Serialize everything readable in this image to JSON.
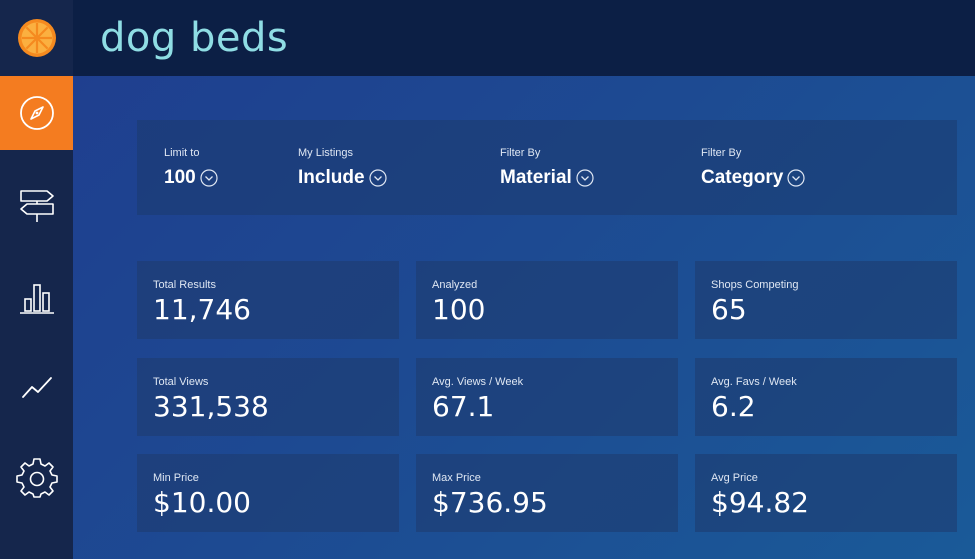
{
  "header": {
    "title": "dog beds"
  },
  "sidebar": {
    "logo_icon": "orange-slice-icon",
    "items": [
      {
        "name": "explore",
        "icon": "compass-icon",
        "active": true
      },
      {
        "name": "directions",
        "icon": "signpost-icon",
        "active": false
      },
      {
        "name": "stats",
        "icon": "bar-chart-icon",
        "active": false
      },
      {
        "name": "trends",
        "icon": "trend-line-icon",
        "active": false
      },
      {
        "name": "settings",
        "icon": "gear-icon",
        "active": false
      }
    ]
  },
  "filters": [
    {
      "label": "Limit to",
      "value": "100"
    },
    {
      "label": "My Listings",
      "value": "Include"
    },
    {
      "label": "Filter By",
      "value": "Material"
    },
    {
      "label": "Filter By",
      "value": "Category"
    }
  ],
  "stats": [
    {
      "label": "Total Results",
      "value": "11,746"
    },
    {
      "label": "Analyzed",
      "value": "100"
    },
    {
      "label": "Shops Competing",
      "value": "65"
    },
    {
      "label": "Total Views",
      "value": "331,538"
    },
    {
      "label": "Avg. Views / Week",
      "value": "67.1"
    },
    {
      "label": "Avg. Favs / Week",
      "value": "6.2"
    },
    {
      "label": "Min Price",
      "value": "$10.00"
    },
    {
      "label": "Max Price",
      "value": "$736.95"
    },
    {
      "label": "Avg Price",
      "value": "$94.82"
    }
  ],
  "colors": {
    "accent": "#f47c20",
    "title": "#8fdde4",
    "sidebar": "#15264c",
    "header": "#0c1f45"
  }
}
